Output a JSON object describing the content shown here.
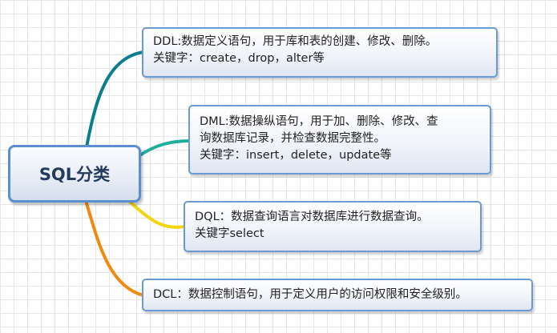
{
  "root": {
    "label": "SQL分类"
  },
  "nodes": [
    {
      "id": "ddl",
      "lines": [
        "DDL:数据定义语句，用于库和表的创建、修改、删除。",
        "关键字：create，drop，alter等"
      ],
      "branch_color": "#0b7e8c"
    },
    {
      "id": "dml",
      "lines": [
        "DML:数据操纵语句，用于加、删除、修改、查",
        "询数据库记录，并检查数据完整性。",
        "关键字：insert，delete，update等"
      ],
      "branch_color": "#1fae9a"
    },
    {
      "id": "dql",
      "lines": [
        "DQL：数据查询语言对数据库进行数据查询。",
        "关键字select"
      ],
      "branch_color": "#f2d40f"
    },
    {
      "id": "dcl",
      "lines": [
        "DCL：数据控制语句，用于定义用户的访问权限和安全级别。"
      ],
      "branch_color": "#f08a12"
    }
  ]
}
